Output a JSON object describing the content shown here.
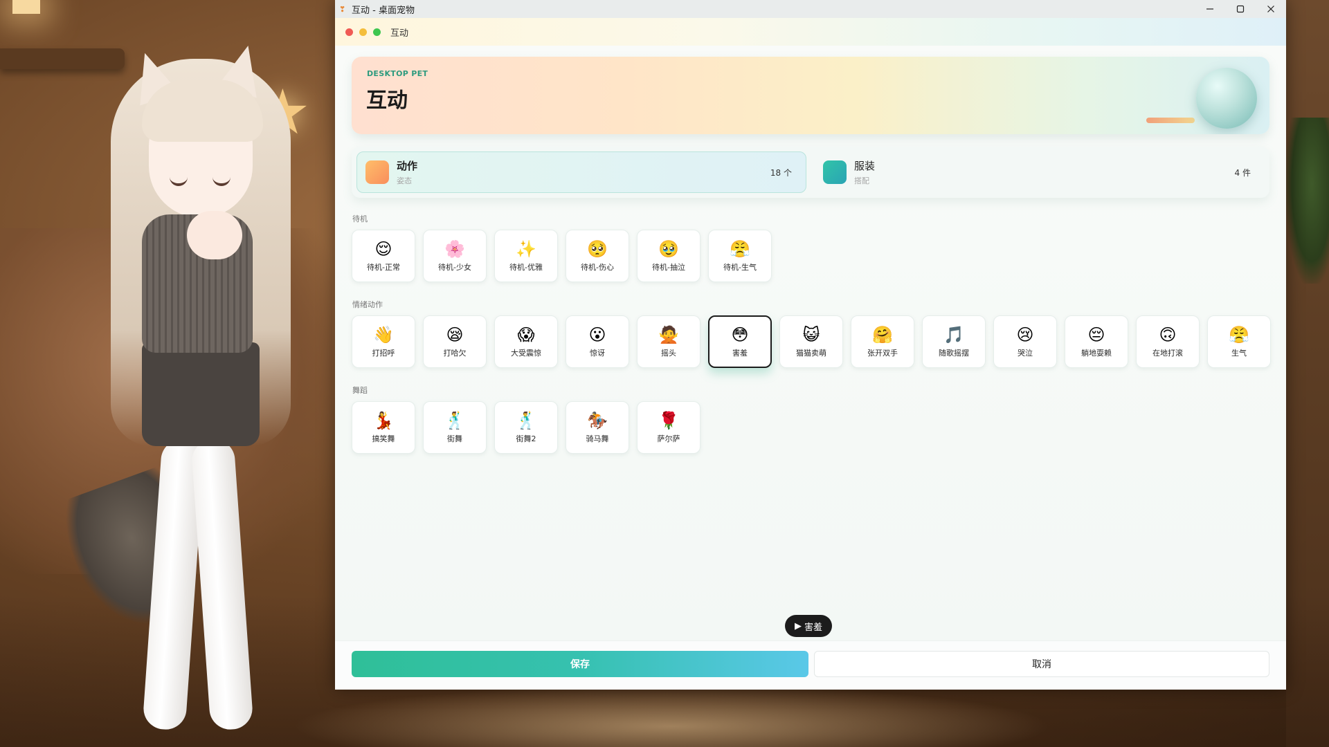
{
  "window": {
    "title": "互动 - 桌面宠物",
    "app_icon": "paw-icon"
  },
  "appbar": {
    "title": "互动"
  },
  "hero": {
    "subtitle": "DESKTOP PET",
    "title": "互动"
  },
  "tabs": [
    {
      "label": "动作",
      "sub": "姿态",
      "count": "18 个",
      "icon": "action-icon",
      "color": "#f98e5c"
    },
    {
      "label": "服装",
      "sub": "搭配",
      "count": "4 件",
      "icon": "outfit-icon",
      "color": "#2aa4b4"
    }
  ],
  "sections": {
    "idle": {
      "title": "待机",
      "items": [
        {
          "label": "待机-正常",
          "emoji": "😌"
        },
        {
          "label": "待机-少女",
          "emoji": "🌸"
        },
        {
          "label": "待机-优雅",
          "emoji": "✨"
        },
        {
          "label": "待机-伤心",
          "emoji": "🥺"
        },
        {
          "label": "待机-抽泣",
          "emoji": "🥹"
        },
        {
          "label": "待机-生气",
          "emoji": "😤"
        }
      ]
    },
    "emotion": {
      "title": "情绪动作",
      "items": [
        {
          "label": "打招呼",
          "emoji": "👋"
        },
        {
          "label": "打哈欠",
          "emoji": "😪"
        },
        {
          "label": "大受震惊",
          "emoji": "😱"
        },
        {
          "label": "惊讶",
          "emoji": "😮"
        },
        {
          "label": "摇头",
          "emoji": "🙅"
        },
        {
          "label": "害羞",
          "emoji": "😳",
          "selected": true
        },
        {
          "label": "猫猫卖萌",
          "emoji": "😺"
        },
        {
          "label": "张开双手",
          "emoji": "🤗"
        },
        {
          "label": "随歌摇摆",
          "emoji": "🎵"
        },
        {
          "label": "哭泣",
          "emoji": "😢"
        },
        {
          "label": "躺地耍赖",
          "emoji": "😔"
        },
        {
          "label": "在地打滚",
          "emoji": "🙃"
        },
        {
          "label": "生气",
          "emoji": "😤"
        }
      ]
    },
    "dance": {
      "title": "舞蹈",
      "items": [
        {
          "label": "搞笑舞",
          "emoji": "💃"
        },
        {
          "label": "街舞",
          "emoji": "🕺"
        },
        {
          "label": "街舞2",
          "emoji": "🕺"
        },
        {
          "label": "骑马舞",
          "emoji": "🏇"
        },
        {
          "label": "萨尔萨",
          "emoji": "🌹"
        }
      ]
    }
  },
  "now_playing": {
    "icon": "▶",
    "label": "害羞"
  },
  "footer": {
    "save_label": "保存",
    "cancel_label": "取消"
  },
  "colors": {
    "accent": "#2fbf98",
    "accent_end": "#5ac8e8",
    "selected_border": "#1b1b1b"
  }
}
